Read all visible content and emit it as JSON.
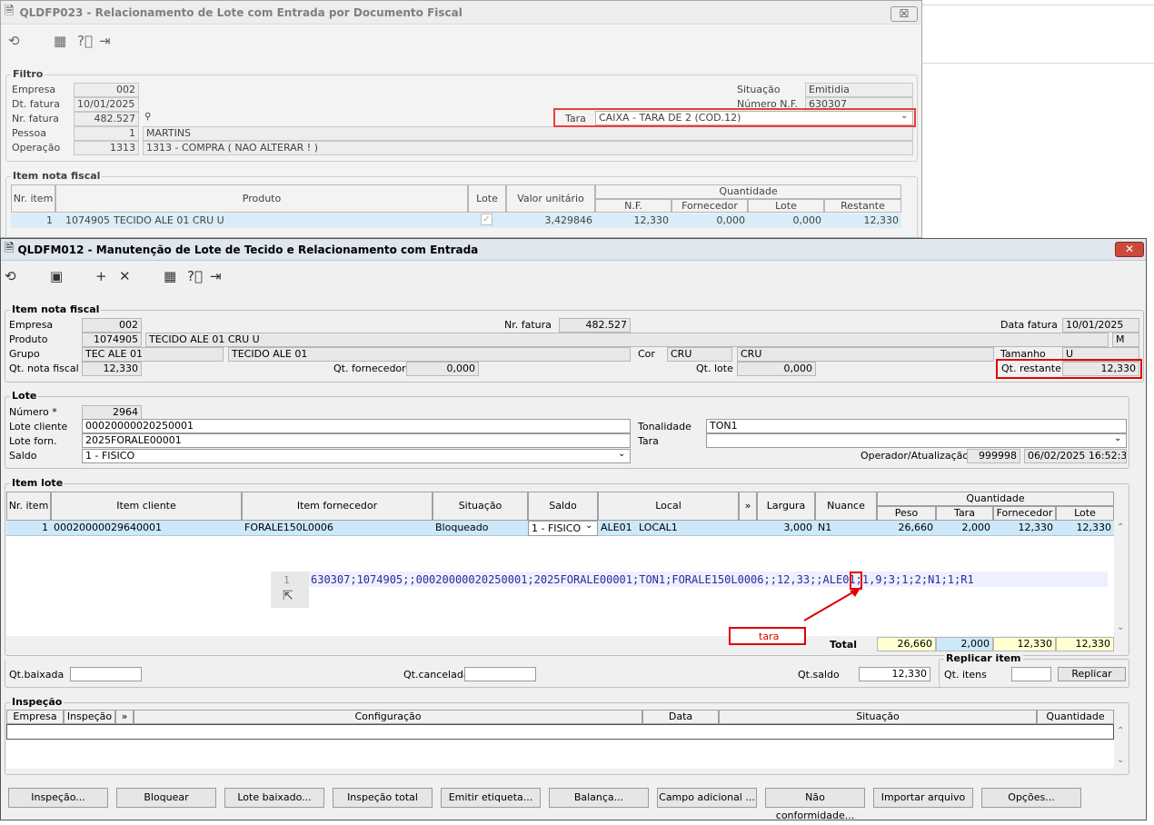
{
  "win1": {
    "title": "QLDFP023 - Relacionamento de Lote com Entrada por Documento Fiscal",
    "close": "☒",
    "filtro": {
      "legend": "Filtro",
      "empresa_label": "Empresa",
      "empresa": "002",
      "dt_fatura_label": "Dt. fatura",
      "dt_fatura": "10/01/2025",
      "nr_fatura_label": "Nr. fatura",
      "nr_fatura": "482.527",
      "pessoa_label": "Pessoa",
      "pessoa_code": "1",
      "pessoa_name": "MARTINS",
      "operacao_label": "Operação",
      "operacao_code": "1313",
      "operacao_desc": "1313 - COMPRA ( NAO ALTERAR ! )",
      "situacao_label": "Situação",
      "situacao": "Emitidia",
      "numero_nf_label": "Número N.F.",
      "numero_nf": "630307",
      "tara_label": "Tara",
      "tara": "CAIXA - TARA DE 2 (COD.12)"
    },
    "item_nf": {
      "legend": "Item nota fiscal",
      "headers": {
        "nr_item": "Nr. item",
        "produto": "Produto",
        "lote": "Lote",
        "valor_unitario": "Valor unitário",
        "quantidade": "Quantidade",
        "nf": "N.F.",
        "fornecedor": "Fornecedor",
        "lote_q": "Lote",
        "restante": "Restante"
      },
      "row": {
        "nr_item": "1",
        "produto_code": "1074905",
        "produto": "TECIDO ALE 01 CRU U",
        "valor_unitario": "3,429846",
        "nf": "12,330",
        "fornecedor": "0,000",
        "lote": "0,000",
        "restante": "12,330"
      }
    }
  },
  "win2": {
    "title": "QLDFM012 - Manutenção de Lote de Tecido e Relacionamento com Entrada",
    "close": "✕",
    "item_nf": {
      "legend": "Item nota fiscal",
      "empresa_label": "Empresa",
      "empresa": "002",
      "produto_label": "Produto",
      "produto_code": "1074905",
      "produto": "TECIDO ALE 01 CRU U",
      "grupo_label": "Grupo",
      "grupo_code": "TEC ALE 01",
      "grupo": "TECIDO ALE 01",
      "qt_nf_label": "Qt. nota fiscal",
      "qt_nf": "12,330",
      "nr_fatura_label": "Nr. fatura",
      "nr_fatura": "482.527",
      "qt_fornecedor_label": "Qt. fornecedor",
      "qt_fornecedor": "0,000",
      "cor_label": "Cor",
      "cor_code": "CRU",
      "cor": "CRU",
      "qt_lote_label": "Qt. lote",
      "qt_lote": "0,000",
      "data_fatura_label": "Data fatura",
      "data_fatura": "10/01/2025",
      "m": "M",
      "tamanho_label": "Tamanho",
      "tamanho": "U",
      "qt_restante_label": "Qt. restante",
      "qt_restante": "12,330"
    },
    "lote": {
      "legend": "Lote",
      "numero_label": "Número *",
      "numero": "2964",
      "lote_cliente_label": "Lote cliente",
      "lote_cliente": "00020000020250001",
      "lote_forn_label": "Lote forn.",
      "lote_forn": "2025FORALE00001",
      "saldo_label": "Saldo",
      "saldo": "1 - FISICO",
      "tonalidade_label": "Tonalidade",
      "tonalidade": "TON1",
      "tara_label": "Tara",
      "tara": "",
      "operador_label": "Operador/Atualização",
      "operador": "999998",
      "atualizacao": "06/02/2025 16:52:37"
    },
    "item_lote": {
      "legend": "Item lote",
      "headers": {
        "nr_item": "Nr. item",
        "item_cliente": "Item cliente",
        "item_fornecedor": "Item fornecedor",
        "situacao": "Situação",
        "saldo": "Saldo",
        "local": "Local",
        "more": "»",
        "largura": "Largura",
        "nuance": "Nuance",
        "quantidade": "Quantidade",
        "peso": "Peso",
        "tara": "Tara",
        "fornecedor": "Fornecedor",
        "lote": "Lote"
      },
      "row": {
        "nr_item": "1",
        "item_cliente": "00020000029640001",
        "item_fornecedor": "FORALE150L0006",
        "situacao": "Bloqueado",
        "saldo": "1 - FISICO",
        "local_code": "ALE01",
        "local": "LOCAL1",
        "largura": "3,000",
        "nuance": "N1",
        "peso": "26,660",
        "tara": "2,000",
        "fornecedor": "12,330",
        "lote": "12,330"
      },
      "code_line_no": "1",
      "code_line": "630307;1074905;;00020000020250001;2025FORALE00001;TON1;FORALE150L0006;;12,33;;ALE01;1,9;3;1;2;N1;1;R1",
      "annotation": "tara",
      "total_label": "Total",
      "totals": {
        "peso": "26,660",
        "tara": "2,000",
        "fornecedor": "12,330",
        "lote": "12,330"
      }
    },
    "bottom": {
      "qt_baixada_label": "Qt.baixada",
      "qt_baixada": "",
      "qt_cancelada_label": "Qt.cancelada",
      "qt_cancelada": "",
      "qt_saldo_label": "Qt.saldo",
      "qt_saldo": "12,330",
      "replicar_legend": "Replicar item",
      "qt_itens_label": "Qt. itens",
      "qt_itens": "",
      "replicar_button": "Replicar"
    },
    "inspecao": {
      "legend": "Inspeção",
      "headers": {
        "empresa": "Empresa",
        "inspecao": "Inspeção",
        "more": "»",
        "configuracao": "Configuração",
        "data": "Data",
        "situacao": "Situação",
        "quantidade": "Quantidade"
      }
    },
    "buttons": [
      "Inspeção...",
      "Bloquear",
      "Lote baixado...",
      "Inspeção total",
      "Emitir etiqueta...",
      "Balança...",
      "Campo adicional ...",
      "Não conformidade...",
      "Importar arquivo",
      "Opções..."
    ]
  },
  "colors": {
    "selected_row": "#cde8f8",
    "total_yellow": "#ffffd0",
    "highlight_red": "#e00000",
    "code_text": "#2b2b9a"
  }
}
